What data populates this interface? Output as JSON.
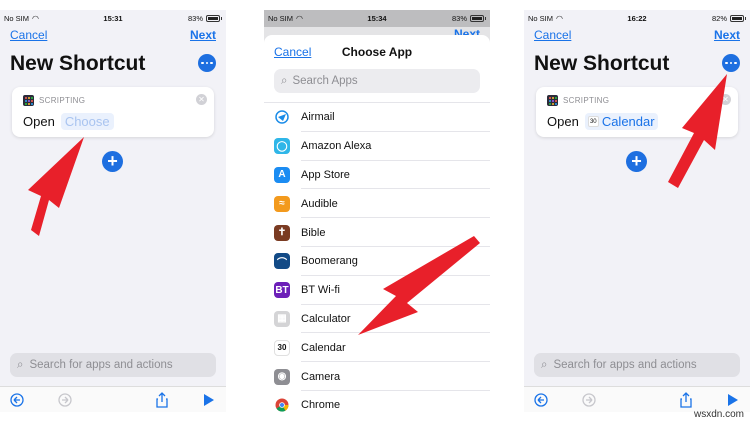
{
  "left": {
    "status": {
      "carrier": "No SIM",
      "time": "15:31",
      "battery": "83%",
      "battery_level": 0.83
    },
    "nav": {
      "cancel": "Cancel",
      "next": "Next"
    },
    "title": "New Shortcut",
    "card": {
      "category": "SCRIPTING",
      "verb": "Open",
      "token": "Choose"
    },
    "bottom_search_placeholder": "Search for apps and actions"
  },
  "middle": {
    "status": {
      "carrier": "No SIM",
      "time": "15:34",
      "battery": "83%",
      "battery_level": 0.83
    },
    "peek_next": "Next",
    "sheet": {
      "cancel": "Cancel",
      "title": "Choose App",
      "search_placeholder": "Search Apps"
    },
    "apps": [
      {
        "name": "Airmail",
        "icon": "airmail-icon",
        "color": "#ffffff",
        "glyph": ""
      },
      {
        "name": "Amazon Alexa",
        "icon": "alexa-icon",
        "color": "#2fb6e8",
        "glyph": "◯"
      },
      {
        "name": "App Store",
        "icon": "app-store-icon",
        "color": "#1b8cf2",
        "glyph": "A"
      },
      {
        "name": "Audible",
        "icon": "audible-icon",
        "color": "#f39a1d",
        "glyph": "≈"
      },
      {
        "name": "Bible",
        "icon": "bible-icon",
        "color": "#7a3b22",
        "glyph": "✝"
      },
      {
        "name": "Boomerang",
        "icon": "boomerang-icon",
        "color": "#124a86",
        "glyph": "⌒"
      },
      {
        "name": "BT Wi-fi",
        "icon": "bt-wifi-icon",
        "color": "#6c1fb8",
        "glyph": "BT"
      },
      {
        "name": "Calculator",
        "icon": "calculator-icon",
        "color": "#d4d4d6",
        "glyph": "▦"
      },
      {
        "name": "Calendar",
        "icon": "calendar-icon",
        "color": "#ffffff",
        "glyph": "30"
      },
      {
        "name": "Camera",
        "icon": "camera-icon",
        "color": "#8e8e93",
        "glyph": "◉"
      },
      {
        "name": "Chrome",
        "icon": "chrome-icon",
        "color": "#ffffff",
        "glyph": ""
      }
    ]
  },
  "right": {
    "status": {
      "carrier": "No SIM",
      "time": "16:22",
      "battery": "82%",
      "battery_level": 0.82
    },
    "nav": {
      "cancel": "Cancel",
      "next": "Next"
    },
    "title": "New Shortcut",
    "card": {
      "category": "SCRIPTING",
      "verb": "Open",
      "token": "Calendar",
      "token_icon": "30"
    },
    "bottom_search_placeholder": "Search for apps and actions"
  },
  "watermark": "wsxdn.com",
  "colors": {
    "accent": "#1a73e8",
    "arrow": "#e8202a"
  }
}
